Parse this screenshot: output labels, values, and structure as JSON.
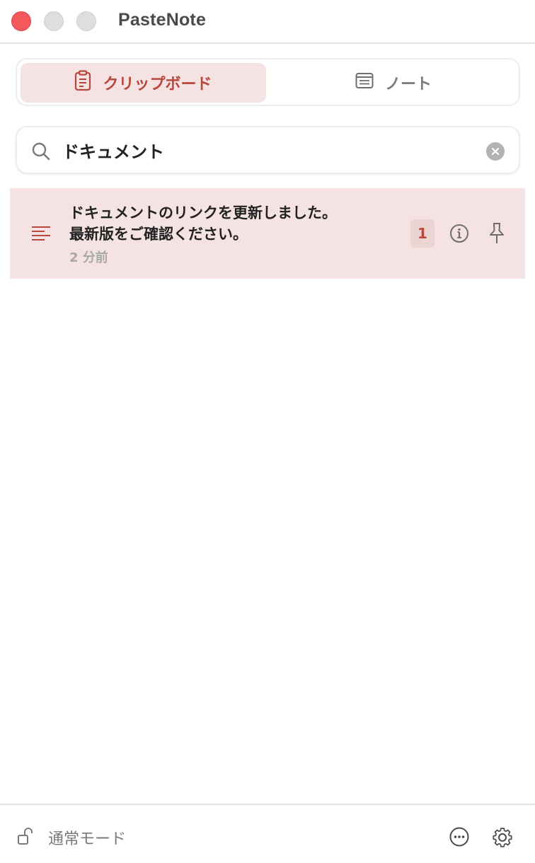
{
  "window": {
    "title": "PasteNote"
  },
  "tabs": [
    {
      "label": "クリップボード",
      "icon": "clipboard-icon",
      "active": true
    },
    {
      "label": "ノート",
      "icon": "note-icon",
      "active": false
    }
  ],
  "search": {
    "value": "ドキュメント",
    "icon": "search-icon"
  },
  "results": [
    {
      "line1": "ドキュメントのリンクを更新しました。",
      "line2": "最新版をご確認ください。",
      "time": "2 分前",
      "count": "1",
      "type_icon": "text-lines-icon"
    }
  ],
  "footer": {
    "mode_label": "通常モード",
    "lock_icon": "unlock-icon"
  },
  "colors": {
    "accent": "#b8473d",
    "selected_bg": "#f4e3e2",
    "close_button": "#f25a5c"
  }
}
